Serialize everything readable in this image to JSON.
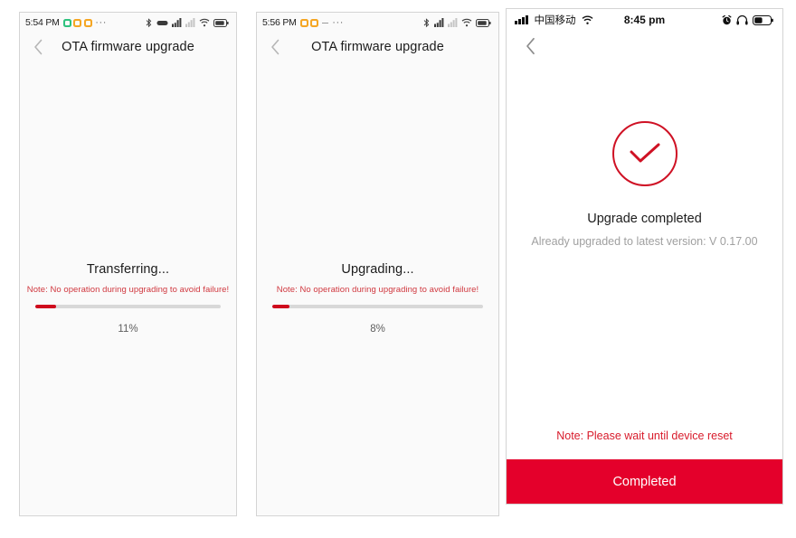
{
  "panels": [
    {
      "id": "transferring",
      "statusbar": {
        "time": "5:54 PM",
        "app_icons": [
          "green-app-icon",
          "orange-app-icon",
          "orange-app-icon"
        ],
        "overflow": "···",
        "right_icons": [
          "bluetooth-icon",
          "vpn-icon",
          "mobile-signal-icon",
          "signal-bars-icon",
          "wifi-icon",
          "battery-icon"
        ]
      },
      "nav": {
        "back": "chevron-left-icon",
        "title": "OTA firmware upgrade"
      },
      "progress": {
        "title": "Transferring...",
        "note": "Note: No operation during upgrading to avoid failure!",
        "percent_label": "11%",
        "percent_value": 11,
        "fill_color": "#cf0a1d",
        "track_color": "#d8d8d8"
      }
    },
    {
      "id": "upgrading",
      "statusbar": {
        "time": "5:56 PM",
        "app_icons": [
          "orange-app-icon",
          "orange-app-icon"
        ],
        "dash": "dash-icon",
        "overflow": "···",
        "right_icons": [
          "bluetooth-icon",
          "mobile-signal-icon",
          "signal-bars-icon",
          "wifi-icon",
          "battery-icon"
        ]
      },
      "nav": {
        "back": "chevron-left-icon",
        "title": "OTA firmware upgrade"
      },
      "progress": {
        "title": "Upgrading...",
        "note": "Note: No operation during upgrading to avoid failure!",
        "percent_label": "8%",
        "percent_value": 8,
        "fill_color": "#cf0a1d",
        "track_color": "#d8d8d8"
      }
    },
    {
      "id": "completed",
      "statusbar": {
        "signal": "signal-bars-icon",
        "carrier": "中国移动",
        "wifi": "wifi-icon",
        "time": "8:45 pm",
        "right_icons": [
          "alarm-clock-icon",
          "headphones-icon",
          "battery-icon"
        ]
      },
      "nav": {
        "back": "chevron-left-icon",
        "title": ""
      },
      "result": {
        "icon": "check-circle-icon",
        "title": "Upgrade completed",
        "subtitle": "Already upgraded to latest version: V 0.17.00",
        "note": "Note: Please wait until device reset",
        "button_label": "Completed",
        "accent_color": "#e4002b",
        "note_color": "#d81b2b"
      }
    }
  ]
}
